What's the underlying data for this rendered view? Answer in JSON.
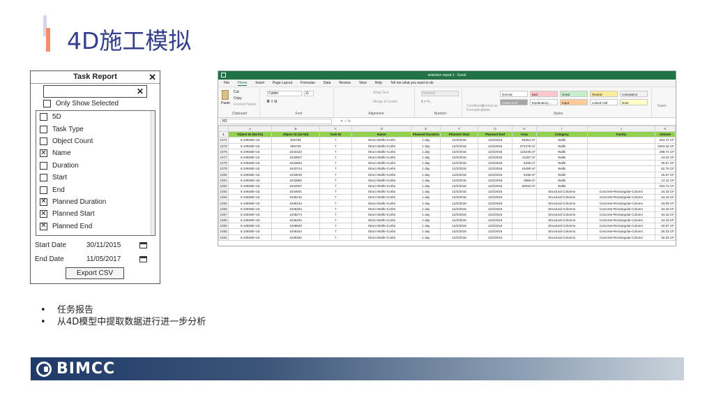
{
  "slide": {
    "title": "4D施工模拟",
    "bullets": [
      "任务报告",
      "从4D模型中提取数据进行进一步分析"
    ],
    "logo_text": "BIMCC",
    "accent_color": "#333e8c",
    "bar_color": "#f0906a"
  },
  "task_report": {
    "title": "Task Report",
    "only_show_selected": "Only Show Selected",
    "fields": [
      {
        "label": "5D",
        "checked": false
      },
      {
        "label": "Task Type",
        "checked": false
      },
      {
        "label": "Object Count",
        "checked": false
      },
      {
        "label": "Name",
        "checked": true
      },
      {
        "label": "Duration",
        "checked": false
      },
      {
        "label": "Start",
        "checked": false
      },
      {
        "label": "End",
        "checked": false
      },
      {
        "label": "Planned Duration",
        "checked": true
      },
      {
        "label": "Planned Start",
        "checked": true
      },
      {
        "label": "Planned End",
        "checked": true
      }
    ],
    "start_date_label": "Start Date",
    "start_date": "30/11/2015",
    "end_date_label": "End Date",
    "end_date": "11/05/2017",
    "export_label": "Export CSV"
  },
  "excel": {
    "window_title": "selection report 1 - Excel",
    "tabs": [
      "File",
      "Home",
      "Insert",
      "Page Layout",
      "Formulas",
      "Data",
      "Review",
      "View",
      "Help",
      "Tell me what you want to do"
    ],
    "active_tab": "Home",
    "ribbon": {
      "groups": [
        "Clipboard",
        "Font",
        "Alignment",
        "Number",
        "Styles"
      ],
      "clipboard": [
        "Paste",
        "Cut",
        "Copy",
        "Format Painter"
      ],
      "font_name": "Calibri",
      "font_size": "11",
      "wrap_text": "Wrap Text",
      "merge_center": "Merge & Center",
      "number_format": "General",
      "conditional": "Conditional Formatting",
      "format_as_table": "Format as Table",
      "styles": [
        "Normal",
        "Bad",
        "Good",
        "Neutral",
        "Calculation",
        "Check Cell",
        "Explanatory ...",
        "Input",
        "Linked Cell",
        "Note"
      ],
      "insert": "Insert"
    },
    "name_box": "M1",
    "column_letters": [
      "A",
      "B",
      "C",
      "D",
      "E",
      "F",
      "G",
      "H",
      "I",
      "J",
      "K"
    ],
    "headers": [
      "Object ID (64-bit)",
      "Object ID (32-bit)",
      "Task ID",
      "Name",
      "Planned Duration",
      "Planned Start",
      "Planned End",
      "Area",
      "Category",
      "Family",
      "Volume"
    ],
    "header_row_number": "1",
    "rows": [
      [
        "1074",
        "8.10926E+15",
        "946786",
        "7",
        "Struct Walls+Curbs",
        "1 day",
        "12/2/2016",
        "12/2/2016",
        "64254 in²",
        "Walls",
        "",
        "254.72 CF"
      ],
      [
        "1075",
        "8.10926E+15",
        "955725",
        "7",
        "Struct Walls+Curbs",
        "1 day",
        "12/2/2016",
        "12/2/2016",
        "372479 in²",
        "Walls",
        "",
        "1503.32 CF"
      ],
      [
        "1076",
        "8.10926E+15",
        "1043422",
        "7",
        "Struct Walls+Curbs",
        "1 day",
        "12/2/2016",
        "12/2/2016",
        "123235 in²",
        "Walls",
        "",
        "498.74 CF"
      ],
      [
        "1077",
        "8.10926E+15",
        "1043507",
        "7",
        "Struct Walls+Curbs",
        "1 day",
        "12/2/2016",
        "12/2/2016",
        "11287 in²",
        "Walls",
        "",
        "43.24 CF"
      ],
      [
        "1078",
        "8.10926E+15",
        "1043584",
        "7",
        "Struct Walls+Curbs",
        "1 day",
        "12/2/2016",
        "12/2/2016",
        "6336 in²",
        "Walls",
        "",
        "25.67 CF"
      ],
      [
        "1079",
        "8.10926E+15",
        "1043724",
        "7",
        "Struct Walls+Curbs",
        "1 day",
        "12/2/2016",
        "12/2/2016",
        "15490 in²",
        "Walls",
        "",
        "62.75 CF"
      ],
      [
        "1080",
        "8.10926E+15",
        "1043819",
        "7",
        "Struct Walls+Curbs",
        "1 day",
        "12/2/2016",
        "12/2/2016",
        "6336 in²",
        "Walls",
        "",
        "25.67 CF"
      ],
      [
        "1081",
        "8.10926E+15",
        "1043860",
        "7",
        "Struct Walls+Curbs",
        "1 day",
        "12/2/2016",
        "12/2/2016",
        "2989 in²",
        "Walls",
        "",
        "12.11 CF"
      ],
      [
        "1082",
        "8.10926E+15",
        "1044007",
        "7",
        "Struct Walls+Curbs",
        "1 day",
        "12/2/2016",
        "12/2/2016",
        "82632 in²",
        "Walls",
        "",
        "334.74 CF"
      ],
      [
        "1083",
        "8.10926E+15",
        "1044601",
        "7",
        "Struct Walls+Curbs",
        "1 day",
        "12/2/2016",
        "12/2/2016",
        "",
        "Structural Columns",
        "Concrete-Rectangular-Column",
        "34.18 CF"
      ],
      [
        "1084",
        "8.10926E+15",
        "1045216",
        "7",
        "Struct Walls+Curbs",
        "1 day",
        "12/2/2016",
        "12/2/2016",
        "",
        "Structural Columns",
        "Concrete-Rectangular-Column",
        "34.18 CF"
      ],
      [
        "1085",
        "8.10926E+15",
        "1045234",
        "7",
        "Struct Walls+Curbs",
        "1 day",
        "12/2/2016",
        "12/2/2016",
        "",
        "Structural Columns",
        "Concrete-Rectangular-Column",
        "33.09 CF"
      ],
      [
        "1086",
        "8.10926E+15",
        "1045254",
        "7",
        "Struct Walls+Curbs",
        "1 day",
        "12/2/2016",
        "12/2/2016",
        "",
        "Structural Columns",
        "Concrete-Rectangular-Column",
        "34.18 CF"
      ],
      [
        "1087",
        "8.10926E+15",
        "1045274",
        "7",
        "Struct Walls+Curbs",
        "1 day",
        "12/2/2016",
        "12/2/2016",
        "",
        "Structural Columns",
        "Concrete-Rectangular-Column",
        "34.18 CF"
      ],
      [
        "1088",
        "8.10926E+15",
        "1045294",
        "7",
        "Struct Walls+Curbs",
        "1 day",
        "12/2/2016",
        "12/2/2016",
        "",
        "Structural Columns",
        "Concrete-Rectangular-Column",
        "34.18 CF"
      ],
      [
        "1089",
        "8.10926E+15",
        "1048820",
        "7",
        "Struct Walls+Curbs",
        "1 day",
        "12/2/2016",
        "12/2/2016",
        "",
        "Structural Columns",
        "Concrete-Rectangular-Column",
        "20.97 CF"
      ],
      [
        "1090",
        "8.10926E+15",
        "1049344",
        "7",
        "Struct Walls+Curbs",
        "1 day",
        "12/2/2016",
        "12/2/2016",
        "",
        "Structural Columns",
        "Concrete-Rectangular-Column",
        "28.33 CF"
      ],
      [
        "1091",
        "8.10926E+15",
        "1049362",
        "7",
        "Struct Walls+Curbs",
        "1 day",
        "12/2/2016",
        "12/2/2016",
        "",
        "Structural Columns",
        "Concrete-Rectangular-Column",
        "28.33 CF"
      ]
    ]
  }
}
